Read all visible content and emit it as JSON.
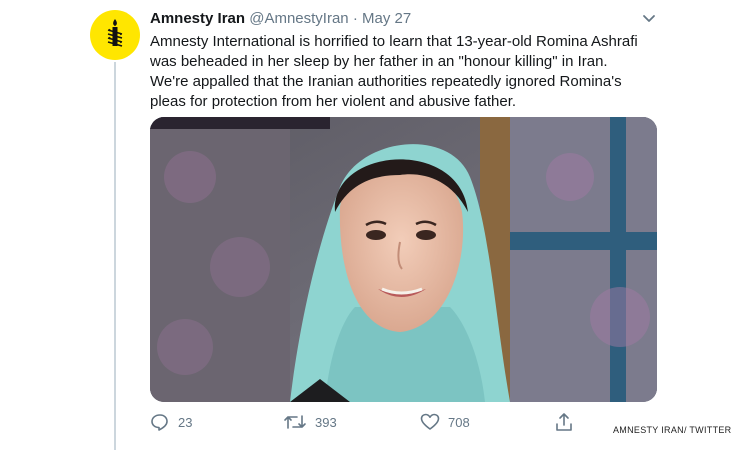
{
  "tweet": {
    "author_name": "Amnesty Iran",
    "handle": "@AmnestyIran",
    "separator": "·",
    "date": "May 27",
    "text_lines": [
      "Amnesty International is horrified to learn that 13-year-old Romina Ashrafi",
      "was beheaded in her sleep by her father in an \"honour killing\" in Iran.",
      "We're appalled that the Iranian authorities repeatedly ignored Romina's",
      "pleas for protection from her violent and abusive father."
    ],
    "actions": {
      "replies": "23",
      "retweets": "393",
      "likes": "708"
    }
  },
  "icons": {
    "avatar": "candle-in-barbed-wire-icon",
    "menu": "chevron-down-icon",
    "reply": "reply-icon",
    "retweet": "retweet-icon",
    "like": "heart-icon",
    "share": "share-icon"
  },
  "colors": {
    "avatar_background": "#ffe600",
    "text": "#14171a",
    "secondary_text": "#657786",
    "thread_line": "#ccd6dd"
  },
  "credit": "AMNESTY IRAN/ TWITTER"
}
